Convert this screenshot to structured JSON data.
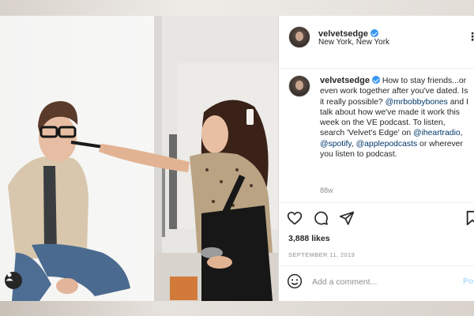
{
  "post": {
    "username": "velvetsedge",
    "location": "New York, New York",
    "verified_color": "#3897f0",
    "caption": {
      "part1": " How to stay friends...or even work together after you've dated. Is it really possible? ",
      "mention1": "@mrbobbybones",
      "part2": " and I talk about how we've made it work this week on the VE podcast. To listen, search 'Velvet's Edge' on ",
      "mention2": "@iheartradio",
      "sep1": ", ",
      "mention3": "@spotify",
      "sep2": ", ",
      "mention4": "@applepodcasts",
      "part3": " or wherever you listen to podcast."
    },
    "time_ago": "88w",
    "likes": "3,888 likes",
    "date": "SEPTEMBER 11, 2019",
    "comment_placeholder": "Add a comment...",
    "post_label": "Post",
    "icons": {
      "like": "heart-icon",
      "comment": "comment-icon",
      "share": "share-icon",
      "save": "bookmark-icon",
      "emoji": "emoji-icon",
      "tagged": "user-tag-icon",
      "more": "more-options-icon"
    }
  }
}
